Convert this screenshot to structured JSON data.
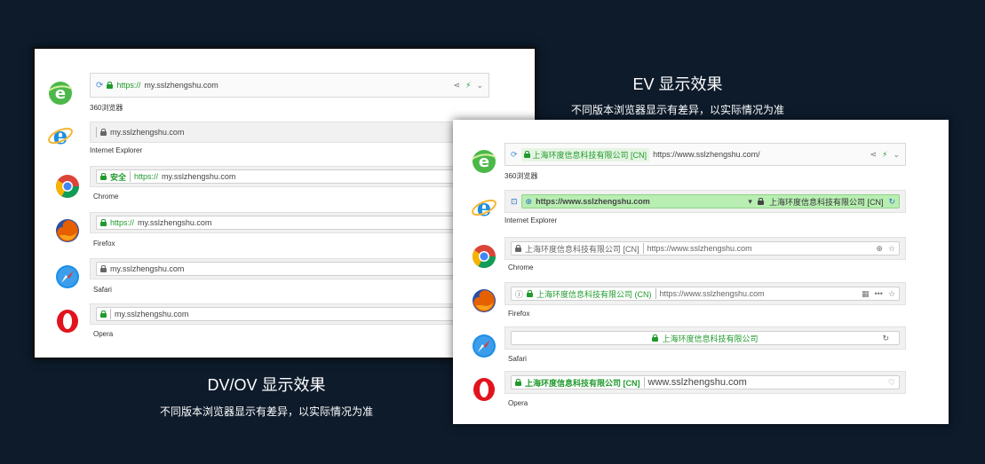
{
  "dv": {
    "title": "DV/OV 显示效果",
    "subtitle": "不同版本浏览器显示有差异，以实际情况为准",
    "browsers": [
      {
        "name": "360浏览器",
        "protocol": "https://",
        "url": "my.sslzhengshu.com"
      },
      {
        "name": "Internet Explorer",
        "url": "my.sslzhengshu.com"
      },
      {
        "name": "Chrome",
        "badge": "安全",
        "protocol": "https://",
        "url": "my.sslzhengshu.com"
      },
      {
        "name": "Firefox",
        "protocol": "https://",
        "url": "my.sslzhengshu.com"
      },
      {
        "name": "Safari",
        "url": "my.sslzhengshu.com"
      },
      {
        "name": "Opera",
        "url": "my.sslzhengshu.com"
      }
    ]
  },
  "ev": {
    "title": "EV 显示效果",
    "subtitle": "不同版本浏览器显示有差异，以实际情况为准",
    "browsers": [
      {
        "name": "360浏览器",
        "org": "上海环度信息科技有限公司 [CN]",
        "url": "https://www.sslzhengshu.com/"
      },
      {
        "name": "Internet Explorer",
        "url": "https://www.sslzhengshu.com",
        "org": "上海环度信息科技有限公司 [CN]"
      },
      {
        "name": "Chrome",
        "org": "上海环度信息科技有限公司 [CN]",
        "url": "https://www.sslzhengshu.com"
      },
      {
        "name": "Firefox",
        "org": "上海环度信息科技有限公司 (CN)",
        "url": "https://www.sslzhengshu.com"
      },
      {
        "name": "Safari",
        "org": "上海环度信息科技有限公司"
      },
      {
        "name": "Opera",
        "org": "上海环度信息科技有限公司 [CN]",
        "url": "www.sslzhengshu.com"
      }
    ]
  },
  "icons": {
    "b360": "360-browser-icon",
    "ie": "internet-explorer-icon",
    "chrome": "chrome-icon",
    "firefox": "firefox-icon",
    "safari": "safari-icon",
    "opera": "opera-icon"
  }
}
